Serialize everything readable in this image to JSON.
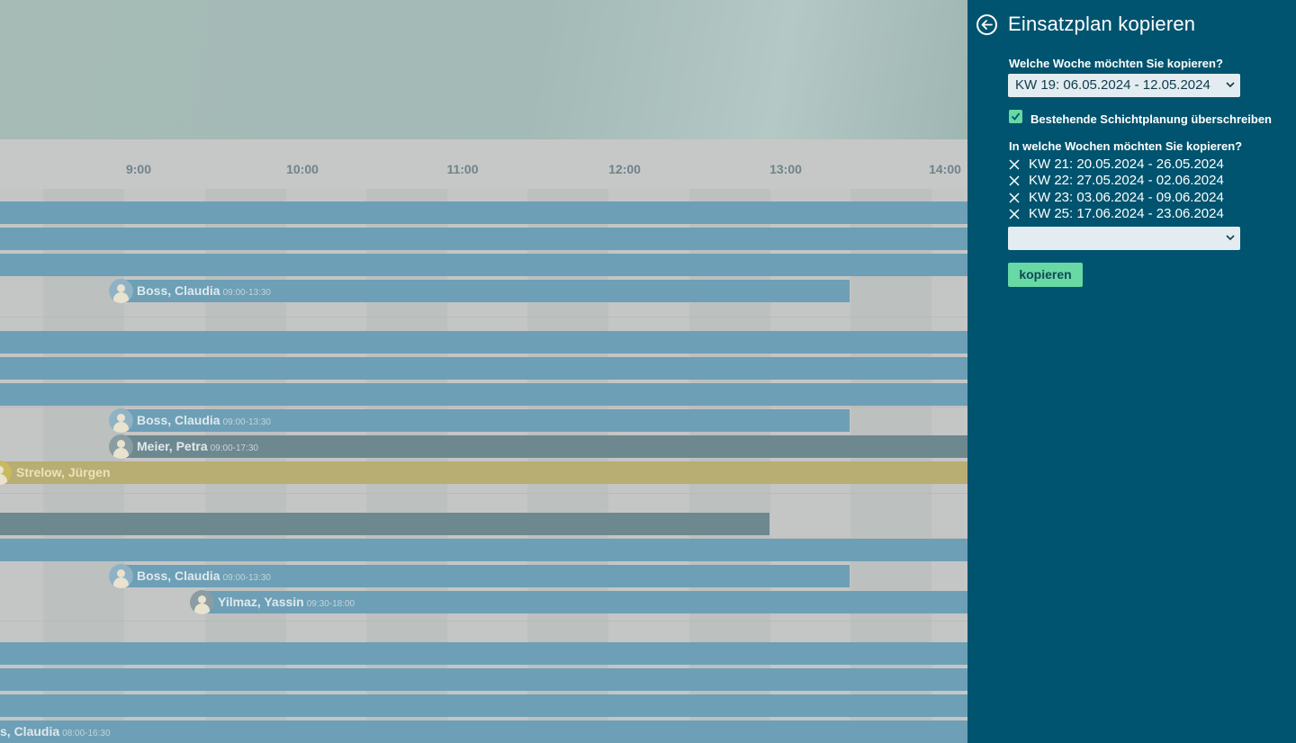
{
  "schedule": {
    "hours": [
      "9:00",
      "10:00",
      "11:00",
      "12:00",
      "13:00",
      "14:00"
    ],
    "shifts": [
      {
        "name": "Boss, Claudia",
        "time": "09:00-13:30"
      },
      {
        "name": "Boss, Claudia",
        "time": "09:00-13:30"
      },
      {
        "name": "Meier, Petra",
        "time": "09:00-17:30"
      },
      {
        "name": "Strelow, Jürgen",
        "time": ""
      },
      {
        "name": "Boss, Claudia",
        "time": "09:00-13:30"
      },
      {
        "name": "Yilmaz, Yassin",
        "time": "09:30-18:00"
      },
      {
        "name": "s, Claudia",
        "time": "08:00-16:30"
      }
    ]
  },
  "panel": {
    "title": "Einsatzplan kopieren",
    "source_week_label": "Welche Woche möchten Sie kopieren?",
    "source_week_value": "KW 19: 06.05.2024 - 12.05.2024",
    "overwrite_label": "Bestehende Schichtplanung überschreiben",
    "overwrite_checked": true,
    "target_weeks_label": "In welche Wochen möchten Sie kopieren?",
    "target_weeks": [
      "KW 21: 20.05.2024 - 26.05.2024",
      "KW 22: 27.05.2024 - 02.06.2024",
      "KW 23: 03.06.2024 - 09.06.2024",
      "KW 25: 17.06.2024 - 23.06.2024"
    ],
    "add_week_value": "",
    "copy_button": "kopieren"
  },
  "colors": {
    "panel_bg": "#01546f",
    "accent": "#68d8a4",
    "bar_blue": "#6d9fb6",
    "bar_gray": "#6e8890",
    "bar_yellow": "#b8ad73"
  },
  "icons": [
    "arrow-left-icon",
    "chevron-down-icon",
    "checkmark-icon",
    "close-icon",
    "user-avatar-icon"
  ]
}
